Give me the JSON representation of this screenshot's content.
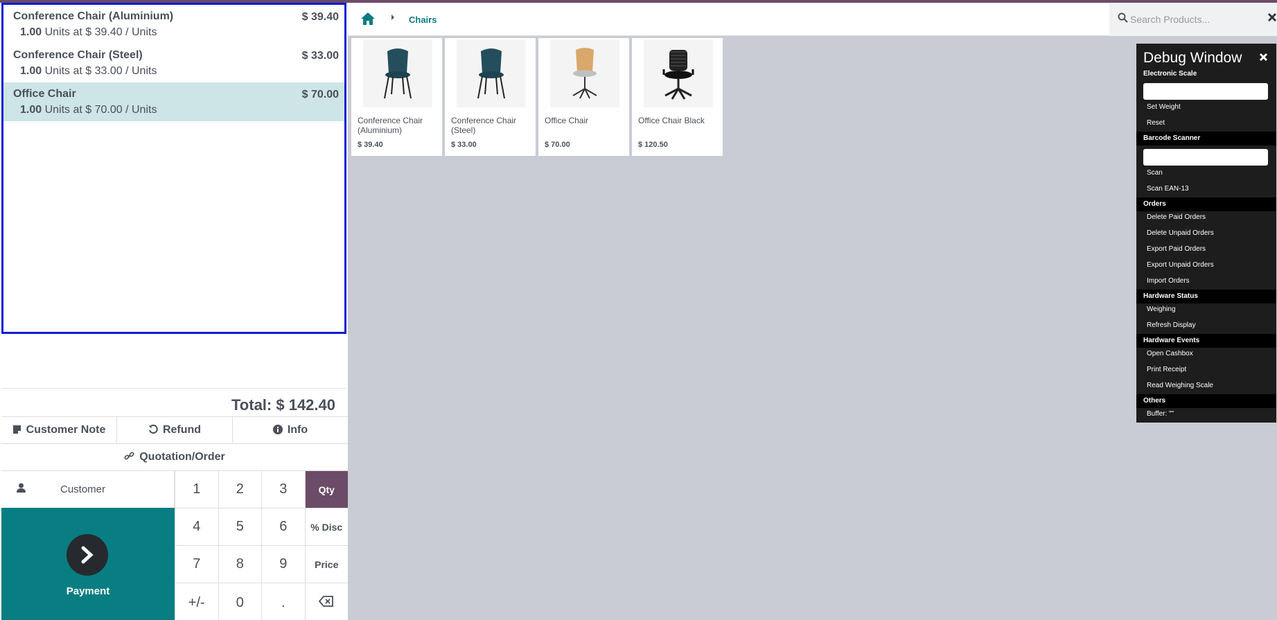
{
  "orderlines": [
    {
      "name": "Conference Chair (Aluminium)",
      "price": "$ 39.40",
      "qty": "1.00",
      "info": "Units at $ 39.40 / Units",
      "selected": false
    },
    {
      "name": "Conference Chair (Steel)",
      "price": "$ 33.00",
      "qty": "1.00",
      "info": "Units at $ 33.00 / Units",
      "selected": false
    },
    {
      "name": "Office Chair",
      "price": "$ 70.00",
      "qty": "1.00",
      "info": "Units at $ 70.00 / Units",
      "selected": true
    }
  ],
  "total": "Total: $ 142.40",
  "controls": {
    "customer_note": "Customer Note",
    "refund": "Refund",
    "info": "Info",
    "quotation": "Quotation/Order"
  },
  "numpad": {
    "customer": "Customer",
    "payment": "Payment",
    "keys": [
      "1",
      "2",
      "3",
      "Qty",
      "4",
      "5",
      "6",
      "% Disc",
      "7",
      "8",
      "9",
      "Price",
      "+/-",
      "0",
      ".",
      "⌫"
    ],
    "active_mode": "Qty"
  },
  "breadcrumb": {
    "category": "Chairs"
  },
  "search": {
    "placeholder": "Search Products..."
  },
  "products": [
    {
      "name": "Conference Chair (Aluminium)",
      "price": "$ 39.40"
    },
    {
      "name": "Conference Chair (Steel)",
      "price": "$ 33.00"
    },
    {
      "name": "Office Chair",
      "price": "$ 70.00"
    },
    {
      "name": "Office Chair Black",
      "price": "$ 120.50"
    }
  ],
  "debug": {
    "title": "Debug Window",
    "sections": {
      "electronic_scale": "Electronic Scale",
      "barcode_scanner": "Barcode Scanner",
      "orders": "Orders",
      "hardware_status": "Hardware Status",
      "hardware_events": "Hardware Events",
      "others": "Others"
    },
    "items": {
      "set_weight": "Set Weight",
      "reset": "Reset",
      "scan": "Scan",
      "scan_ean13": "Scan EAN-13",
      "delete_paid": "Delete Paid Orders",
      "delete_unpaid": "Delete Unpaid Orders",
      "export_paid": "Export Paid Orders",
      "export_unpaid": "Export Unpaid Orders",
      "import_orders": "Import Orders",
      "weighing": "Weighing",
      "refresh_display": "Refresh Display",
      "open_cashbox": "Open Cashbox",
      "print_receipt": "Print Receipt",
      "read_weighing": "Read Weighing Scale",
      "buffer": "Buffer: \"\""
    }
  },
  "colors": {
    "accent": "#6b4b68",
    "teal": "#087e82",
    "selected_row": "#cde5e6",
    "focus_border": "#0a1cd4"
  }
}
